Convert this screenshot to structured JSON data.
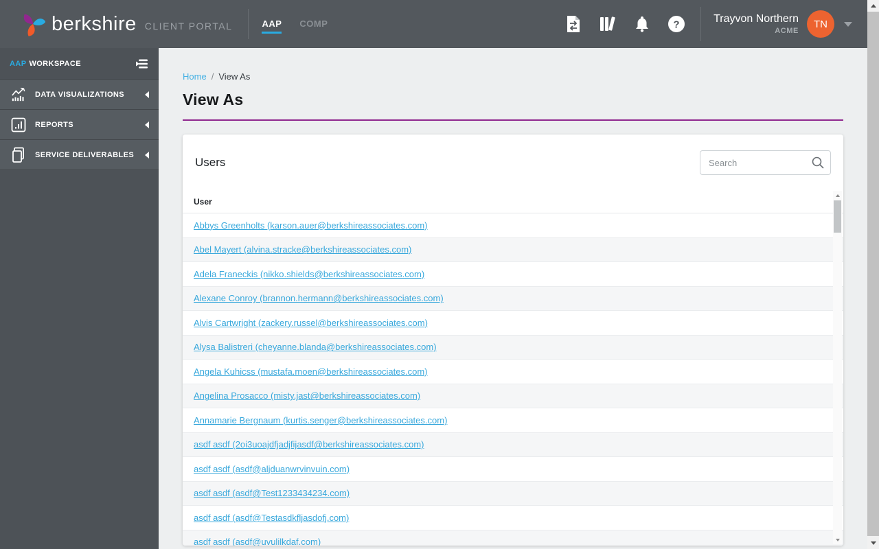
{
  "header": {
    "brand": "berkshire",
    "portal": "CLIENT PORTAL",
    "tabs": [
      {
        "label": "AAP",
        "active": true
      },
      {
        "label": "COMP",
        "active": false
      }
    ],
    "user_name": "Trayvon Northern",
    "user_company": "ACME",
    "user_initials": "TN"
  },
  "sidebar": {
    "workspace_prefix": "AAP",
    "workspace_suffix": "WORKSPACE",
    "items": [
      {
        "label": "DATA VISUALIZATIONS",
        "icon": "chart-trend-icon"
      },
      {
        "label": "REPORTS",
        "icon": "bar-chart-icon"
      },
      {
        "label": "SERVICE DELIVERABLES",
        "icon": "documents-icon"
      }
    ]
  },
  "breadcrumb": {
    "home": "Home",
    "separator": "/",
    "current": "View As"
  },
  "page_title": "View As",
  "users_card": {
    "title": "Users",
    "search_placeholder": "Search",
    "column_header": "User",
    "users": [
      "Abbys Greenholts (karson.auer@berkshireassociates.com)",
      "Abel Mayert (alvina.stracke@berkshireassociates.com)",
      "Adela Franeckis (nikko.shields@berkshireassociates.com)",
      "Alexane Conroy (brannon.hermann@berkshireassociates.com)",
      "Alvis Cartwright (zackery.russel@berkshireassociates.com)",
      "Alysa Balistreri (cheyanne.blanda@berkshireassociates.com)",
      "Angela Kuhicss (mustafa.moen@berkshireassociates.com)",
      "Angelina Prosacco (misty.jast@berkshireassociates.com)",
      "Annamarie Bergnaum (kurtis.senger@berkshireassociates.com)",
      "asdf asdf (2oi3uoajdfjadjfijasdf@berkshireassociates.com)",
      "asdf asdf (asdf@aljduanwrvinvuin.com)",
      "asdf asdf (asdf@Test1233434234.com)",
      "asdf asdf (asdf@Testasdkfljasdofj.com)",
      "asdf asdf (asdf@uvulilkdaf.com)"
    ]
  },
  "colors": {
    "header-bg": "#53585D",
    "sidebar-bg": "#4D5257",
    "accent-blue": "#29ABE2",
    "link-blue": "#38A8DC",
    "purple": "#90278E",
    "avatar-orange": "#ED6330",
    "page-bg": "#EDEFF0"
  }
}
